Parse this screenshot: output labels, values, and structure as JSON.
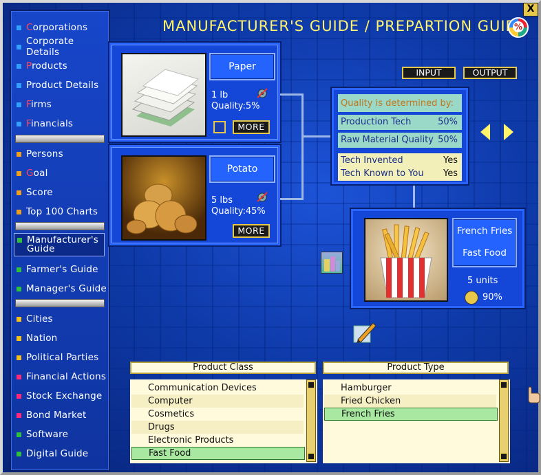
{
  "window": {
    "title": "MANUFACTURER'S GUIDE / PREPARTION GUIDE",
    "close_label": "X",
    "percent_icon_label": "%"
  },
  "sidebar": {
    "items": [
      {
        "first": "C",
        "rest": "orporations",
        "color": "#33a0ff"
      },
      {
        "label": "Corporate Details",
        "color": "#33a0ff"
      },
      {
        "first": "P",
        "rest": "roducts",
        "color": "#33a0ff"
      },
      {
        "label": "Product Details",
        "color": "#33a0ff"
      },
      {
        "first": "F",
        "rest": "irms",
        "color": "#33a0ff"
      },
      {
        "first": "F",
        "rest": "inancials",
        "color": "#33a0ff"
      },
      {
        "label": "Persons",
        "color": "#f0a020"
      },
      {
        "first": "G",
        "rest": "oal",
        "color": "#f0a020"
      },
      {
        "label": "Score",
        "color": "#f0a020"
      },
      {
        "label": "Top 100 Charts",
        "color": "#f0a020"
      },
      {
        "label": "Manufacturer's Guide",
        "color": "#30c040"
      },
      {
        "label": "Farmer's Guide",
        "color": "#30c040"
      },
      {
        "label": "Manager's Guide",
        "color": "#30c040"
      },
      {
        "label": "Cities",
        "color": "#f0c020"
      },
      {
        "label": "Nation",
        "color": "#f0c020"
      },
      {
        "label": "Political Parties",
        "color": "#f0c020"
      },
      {
        "label": "Financial Actions",
        "color": "#ff2a7a"
      },
      {
        "label": "Stock Exchange",
        "color": "#ff2a7a"
      },
      {
        "label": "Bond Market",
        "color": "#ff2a7a"
      },
      {
        "label": "Software",
        "color": "#30c040"
      },
      {
        "label": "Digital Guide",
        "color": "#30c040"
      }
    ],
    "manufacturers_guide_line1": "Manufacturer's",
    "manufacturers_guide_line2": "Guide"
  },
  "inputs": [
    {
      "name": "Paper",
      "amount": "1 lb",
      "quality": "Quality:5%",
      "more": "MORE"
    },
    {
      "name": "Potato",
      "amount": "5 lbs",
      "quality": "Quality:45%",
      "more": "MORE"
    }
  ],
  "io": {
    "input_label": "INPUT",
    "output_label": "OUTPUT"
  },
  "quality_panel": {
    "heading": "Quality is determined by:",
    "rows": [
      {
        "key": "Production Tech",
        "value": "50%"
      },
      {
        "key": "Raw Material Quality",
        "value": "50%"
      },
      {
        "key": "Tech Invented",
        "value": "Yes"
      },
      {
        "key": "Tech Known to You",
        "value": "Yes"
      }
    ]
  },
  "output": {
    "name": "French Fries",
    "category": "Fast Food",
    "units": "5 units",
    "quality": "90%"
  },
  "product_class": {
    "header": "Product Class",
    "items": [
      "Communication Devices",
      "Computer",
      "Cosmetics",
      "Drugs",
      "Electronic Products",
      "Fast Food"
    ],
    "selected": "Fast Food"
  },
  "product_type": {
    "header": "Product Type",
    "items": [
      "Hamburger",
      "Fried Chicken",
      "French Fries"
    ],
    "selected": "French Fries"
  },
  "colors": {
    "title": "#fff46a",
    "panel_blue": "#1447d8",
    "selected_green": "#a8e8a0",
    "accent_gold": "#e8c84a"
  }
}
